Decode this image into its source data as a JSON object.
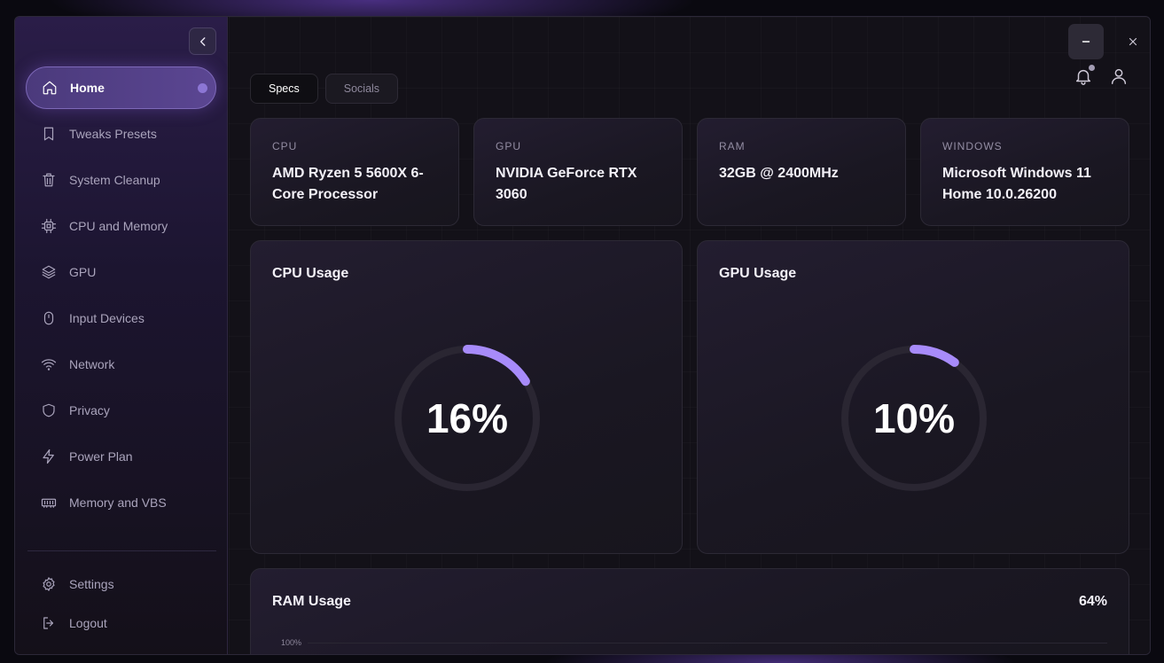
{
  "sidebar": {
    "items": [
      {
        "label": "Home",
        "icon": "home-icon",
        "active": true
      },
      {
        "label": "Tweaks Presets",
        "icon": "bookmark-icon"
      },
      {
        "label": "System Cleanup",
        "icon": "trash-icon"
      },
      {
        "label": "CPU and Memory",
        "icon": "chip-icon"
      },
      {
        "label": "GPU",
        "icon": "layers-icon"
      },
      {
        "label": "Input Devices",
        "icon": "mouse-icon"
      },
      {
        "label": "Network",
        "icon": "wifi-icon"
      },
      {
        "label": "Privacy",
        "icon": "shield-icon"
      },
      {
        "label": "Power Plan",
        "icon": "lightning-icon"
      },
      {
        "label": "Memory and VBS",
        "icon": "memory-icon"
      }
    ],
    "bottom_items": [
      {
        "label": "Settings",
        "icon": "gear-icon"
      },
      {
        "label": "Logout",
        "icon": "logout-icon"
      }
    ]
  },
  "tabs": [
    {
      "label": "Specs",
      "active": true
    },
    {
      "label": "Socials",
      "active": false
    }
  ],
  "specs": [
    {
      "label": "CPU",
      "value": "AMD Ryzen 5 5600X 6-Core Processor"
    },
    {
      "label": "GPU",
      "value": "NVIDIA GeForce RTX 3060"
    },
    {
      "label": "RAM",
      "value": "32GB @ 2400MHz"
    },
    {
      "label": "WINDOWS",
      "value": "Microsoft Windows 11 Home 10.0.26200"
    }
  ],
  "usage": {
    "cpu": {
      "title": "CPU Usage",
      "value_text": "16%",
      "percent": 16
    },
    "gpu": {
      "title": "GPU Usage",
      "value_text": "10%",
      "percent": 10
    }
  },
  "ram": {
    "title": "RAM Usage",
    "value_text": "64%",
    "tick_top": "100%"
  },
  "colors": {
    "accent": "#a78bfa",
    "track": "#2a2632"
  }
}
